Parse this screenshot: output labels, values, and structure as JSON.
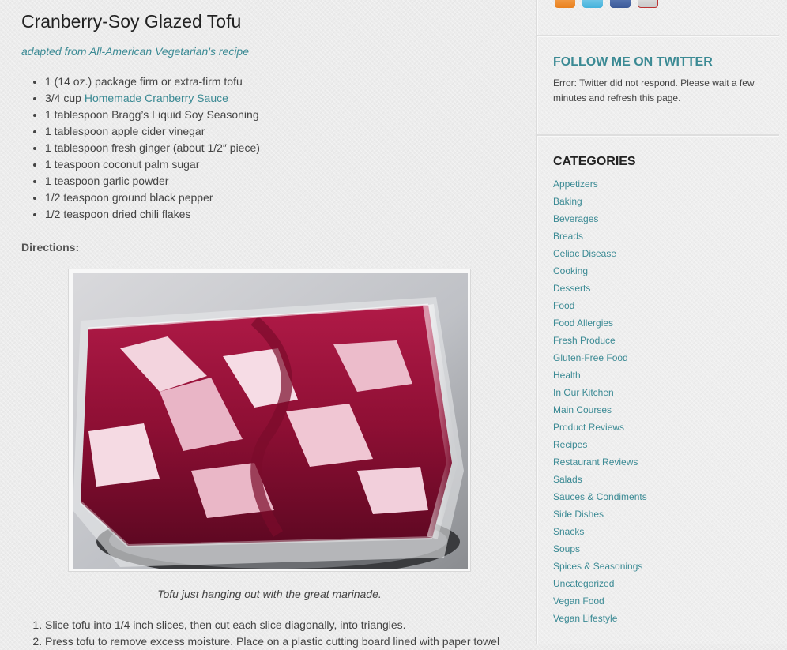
{
  "post": {
    "title": "Cranberry-Soy Glazed Tofu",
    "adapted_text": "adapted from All-American Vegetarian's recipe",
    "ingredients": [
      "1 (14 oz.) package firm or extra-firm tofu",
      "3/4 cup ",
      "1 tablespoon Bragg’s Liquid Soy Seasoning",
      "1 tablespoon apple cider vinegar",
      "1 tablespoon fresh ginger (about 1/2″ piece)",
      "1 teaspoon coconut palm sugar",
      "1 teaspoon garlic powder",
      "1/2 teaspoon ground black pepper",
      "1/2 teaspoon dried chili flakes"
    ],
    "ingredient_link": "Homemade Cranberry Sauce",
    "directions_label": "Directions:",
    "caption": "Tofu just hanging out with the great marinade.",
    "steps": [
      "Slice tofu into 1/4 inch slices, then cut each slice diagonally, into triangles.",
      "Press tofu to remove excess moisture. Place on a plastic cutting board lined with paper towel"
    ]
  },
  "sidebar": {
    "social_icons": [
      "rss-icon",
      "twitter-icon",
      "facebook-icon",
      "youtube-icon"
    ],
    "twitter": {
      "title": "FOLLOW ME ON TWITTER",
      "message": "Error: Twitter did not respond. Please wait a few minutes and refresh this page."
    },
    "categories": {
      "title": "CATEGORIES",
      "items": [
        "Appetizers",
        "Baking",
        "Beverages",
        "Breads",
        "Celiac Disease",
        "Cooking",
        "Desserts",
        "Food",
        "Food Allergies",
        "Fresh Produce",
        "Gluten-Free Food",
        "Health",
        "In Our Kitchen",
        "Main Courses",
        "Product Reviews",
        "Recipes",
        "Restaurant Reviews",
        "Salads",
        "Sauces & Condiments",
        "Side Dishes",
        "Snacks",
        "Soups",
        "Spices & Seasonings",
        "Uncategorized",
        "Vegan Food",
        "Vegan Lifestyle"
      ]
    }
  },
  "colors": {
    "link": "#3b8a94",
    "text": "#444444",
    "background": "#ececec"
  }
}
